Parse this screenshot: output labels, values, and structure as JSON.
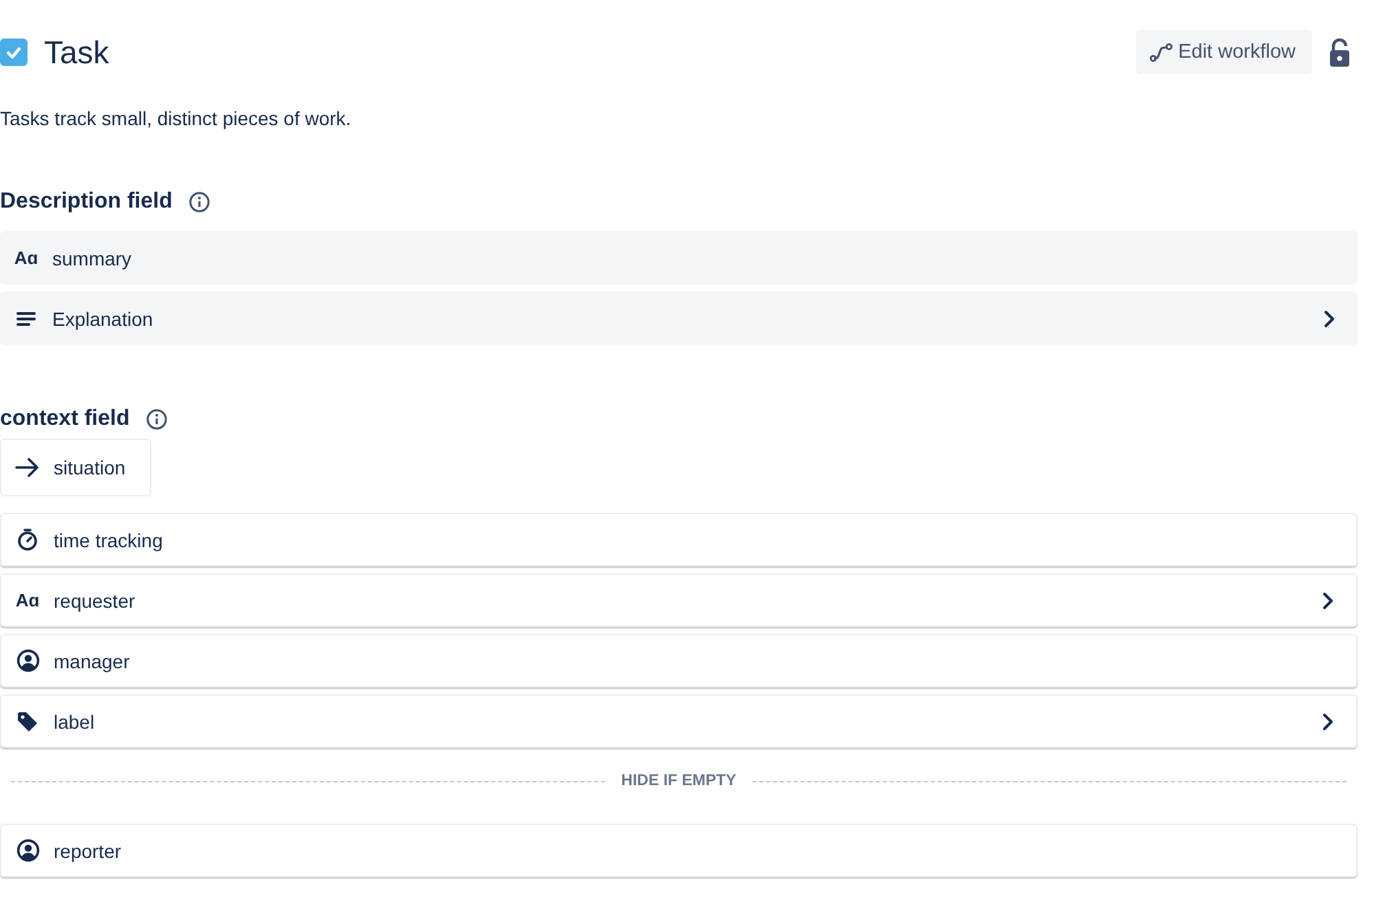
{
  "header": {
    "title": "Task",
    "checked": true,
    "edit_button": "Edit workflow",
    "locked": false
  },
  "description": "Tasks track small, distinct pieces of work.",
  "sections": [
    {
      "title": "Description field",
      "fields": [
        {
          "label": "summary",
          "kind": "text",
          "icon_text": "Aɑ",
          "expandable": false,
          "compact": false
        },
        {
          "label": "Explanation",
          "kind": "paragraph",
          "expandable": true,
          "compact": false
        }
      ]
    },
    {
      "title": "context field",
      "fields": [
        {
          "label": "situation",
          "kind": "arrow",
          "expandable": false,
          "compact": true
        },
        {
          "label": "time tracking",
          "kind": "timer",
          "expandable": false,
          "compact": false
        },
        {
          "label": "requester",
          "kind": "text",
          "icon_text": "Aɑ",
          "expandable": true,
          "compact": false
        },
        {
          "label": "manager",
          "kind": "person",
          "expandable": false,
          "compact": false
        },
        {
          "label": "label",
          "kind": "tag",
          "expandable": true,
          "compact": false
        }
      ],
      "divider": "HIDE IF EMPTY",
      "hidden_fields": [
        {
          "label": "reporter",
          "kind": "person",
          "expandable": false,
          "compact": false
        }
      ]
    }
  ]
}
